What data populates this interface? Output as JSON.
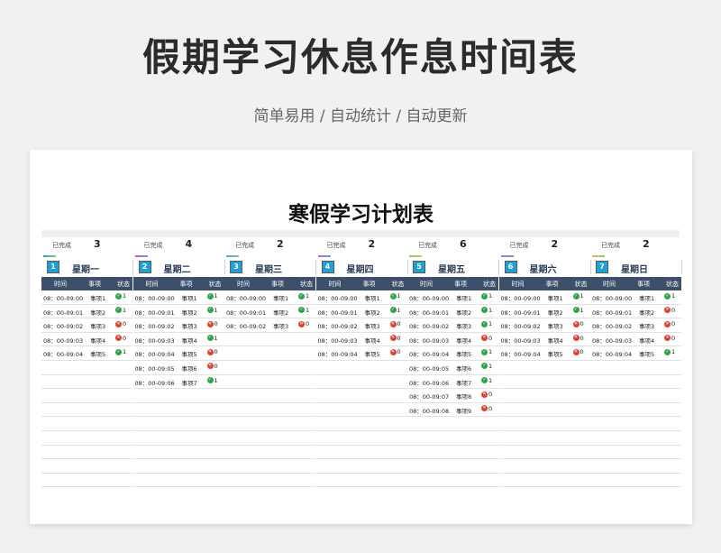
{
  "hero": {
    "title": "假期学习休息作息时间表",
    "subtitle": "简单易用 / 自动统计 / 自动更新"
  },
  "sheet": {
    "title": "寒假学习计划表",
    "done_label": "已完成",
    "headers": {
      "time": "时间",
      "item": "事项",
      "status": "状态"
    },
    "accent_colors": [
      "#1f9fd6",
      "#3d4f6a",
      "#2fa24a",
      "#d8442e"
    ],
    "days": [
      {
        "num": "1",
        "name": "星期一",
        "done": "3",
        "rows": [
          {
            "time": "08：00-09:00",
            "item": "事项1",
            "ok": true,
            "status": "1"
          },
          {
            "time": "08：00-09:01",
            "item": "事项2",
            "ok": true,
            "status": "1"
          },
          {
            "time": "08：00-09:02",
            "item": "事项3",
            "ok": false,
            "status": "0"
          },
          {
            "time": "08：00-09:03",
            "item": "事项4",
            "ok": false,
            "status": "0"
          },
          {
            "time": "08：00-09:04",
            "item": "事项5",
            "ok": true,
            "status": "1"
          }
        ]
      },
      {
        "num": "2",
        "name": "星期二",
        "done": "4",
        "rows": [
          {
            "time": "08：00-09:00",
            "item": "事项1",
            "ok": true,
            "status": "1"
          },
          {
            "time": "08：00-09:01",
            "item": "事项2",
            "ok": true,
            "status": "1"
          },
          {
            "time": "08：00-09:02",
            "item": "事项3",
            "ok": false,
            "status": "0"
          },
          {
            "time": "08：00-09:03",
            "item": "事项4",
            "ok": true,
            "status": "1"
          },
          {
            "time": "08：00-09:04",
            "item": "事项5",
            "ok": false,
            "status": "0"
          },
          {
            "time": "08：00-09:05",
            "item": "事项6",
            "ok": false,
            "status": "0"
          },
          {
            "time": "08：00-09:06",
            "item": "事项7",
            "ok": true,
            "status": "1"
          }
        ]
      },
      {
        "num": "3",
        "name": "星期三",
        "done": "2",
        "rows": [
          {
            "time": "08：00-09:00",
            "item": "事项1",
            "ok": true,
            "status": "1"
          },
          {
            "time": "08：00-09:01",
            "item": "事项2",
            "ok": true,
            "status": "1"
          },
          {
            "time": "08：00-09:02",
            "item": "事项3",
            "ok": false,
            "status": "0"
          }
        ]
      },
      {
        "num": "4",
        "name": "星期四",
        "done": "2",
        "rows": [
          {
            "time": "08：00-09:00",
            "item": "事项1",
            "ok": true,
            "status": "1"
          },
          {
            "time": "08：00-09:01",
            "item": "事项2",
            "ok": true,
            "status": "1"
          },
          {
            "time": "08：00-09:02",
            "item": "事项3",
            "ok": false,
            "status": "0"
          },
          {
            "time": "08：00-09:03",
            "item": "事项4",
            "ok": false,
            "status": "0"
          },
          {
            "time": "08：00-09:04",
            "item": "事项5",
            "ok": false,
            "status": "0"
          }
        ]
      },
      {
        "num": "5",
        "name": "星期五",
        "done": "6",
        "rows": [
          {
            "time": "08：00-09:00",
            "item": "事项1",
            "ok": true,
            "status": "1"
          },
          {
            "time": "08：00-09:01",
            "item": "事项2",
            "ok": true,
            "status": "1"
          },
          {
            "time": "08：00-09:02",
            "item": "事项3",
            "ok": true,
            "status": "1"
          },
          {
            "time": "08：00-09:03",
            "item": "事项4",
            "ok": false,
            "status": "0"
          },
          {
            "time": "08：00-09:04",
            "item": "事项5",
            "ok": true,
            "status": "1"
          },
          {
            "time": "08：00-09:05",
            "item": "事项6",
            "ok": true,
            "status": "1"
          },
          {
            "time": "08：00-09:06",
            "item": "事项7",
            "ok": true,
            "status": "1"
          },
          {
            "time": "08：00-09:07",
            "item": "事项8",
            "ok": false,
            "status": "0"
          },
          {
            "time": "08：00-09:08",
            "item": "事项9",
            "ok": false,
            "status": "0"
          }
        ]
      },
      {
        "num": "6",
        "name": "星期六",
        "done": "2",
        "rows": [
          {
            "time": "08：00-09:00",
            "item": "事项1",
            "ok": true,
            "status": "1"
          },
          {
            "time": "08：00-09:01",
            "item": "事项2",
            "ok": true,
            "status": "1"
          },
          {
            "time": "08：00-09:02",
            "item": "事项3",
            "ok": false,
            "status": "0"
          },
          {
            "time": "08：00-09:03",
            "item": "事项4",
            "ok": false,
            "status": "0"
          },
          {
            "time": "08：00-09:04",
            "item": "事项5",
            "ok": false,
            "status": "0"
          }
        ]
      },
      {
        "num": "7",
        "name": "星期日",
        "done": "2",
        "rows": [
          {
            "time": "08：00-09:00",
            "item": "事项1",
            "ok": true,
            "status": "1"
          },
          {
            "time": "08：00-09:01",
            "item": "事项2",
            "ok": false,
            "status": "0"
          },
          {
            "time": "08：00-09:02",
            "item": "事项3",
            "ok": false,
            "status": "0"
          },
          {
            "time": "08：00-09:03",
            "item": "事项4",
            "ok": false,
            "status": "0"
          },
          {
            "time": "08：00-09:04",
            "item": "事项5",
            "ok": true,
            "status": "1"
          }
        ]
      }
    ]
  }
}
